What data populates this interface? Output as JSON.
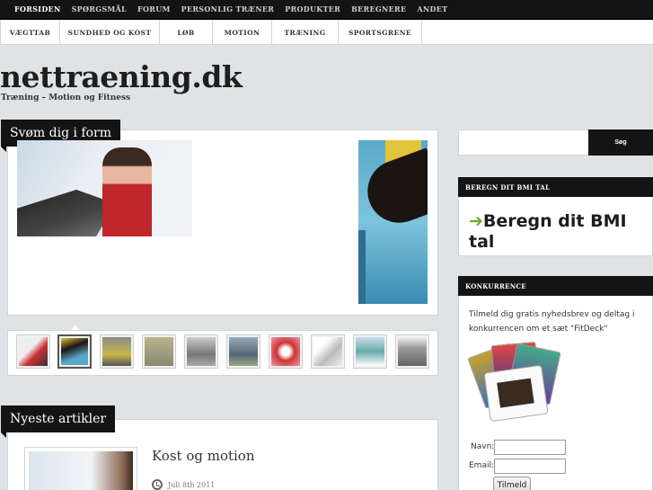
{
  "topnav": {
    "items": [
      "FORSIDEN",
      "SPØRGSMÅL",
      "FORUM",
      "PERSONLIG TRÆNER",
      "PRODUKTER",
      "BEREGNERE",
      "ANDET"
    ]
  },
  "subnav": {
    "tabs": [
      "VÆGTTAB",
      "SUNDHED OG KOST",
      "LØB",
      "MOTION",
      "TRÆNING",
      "SPORTSGRENE"
    ]
  },
  "site": {
    "title": "nettraening.dk",
    "tagline": "Træning – Motion og Fitness"
  },
  "featured": {
    "heading": "Svøm dig i form",
    "selected_thumb": 1,
    "thumb_count": 10
  },
  "latest": {
    "heading": "Nyeste artikler",
    "article_title": "Kost og motion",
    "article_date": "Juli 8th 2011"
  },
  "sidebar": {
    "search_button": "Søg",
    "bmi_heading": "BEREGN DIT BMI TAL",
    "bmi_link": "Beregn dit BMI tal",
    "contest_heading": "KONKURRENCE",
    "contest_text": "Tilmeld dig gratis nyhedsbrev og deltag i konkurrencen om et sæt \"FitDeck\"",
    "name_label": "Navn:",
    "email_label": "Email:",
    "submit_label": "Tilmeld"
  },
  "colors": {
    "nav_bg": "#141414",
    "page_bg": "#dfe3e6",
    "arrow": "#6aa832"
  },
  "icons": {
    "bmi_arrow": "arrow-right-icon",
    "date": "clock-icon"
  }
}
